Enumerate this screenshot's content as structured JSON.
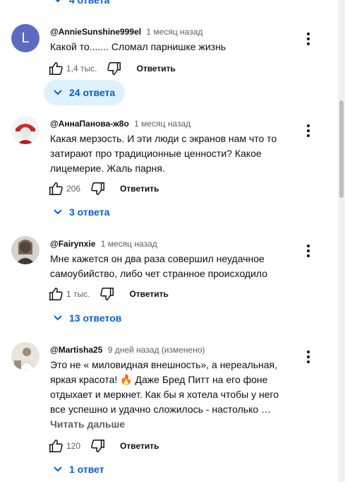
{
  "top_toggle": {
    "label": "4 ответа"
  },
  "comments": [
    {
      "author": "@AnnieSunshine999el",
      "time": "1 месяц назад",
      "avatar_letter": "L",
      "text": "Какой то....... Сломал парнишке жизнь",
      "likes": "1,4 тыс.",
      "reply_label": "Ответить",
      "replies_label": "24 ответа"
    },
    {
      "author": "@АннаПанова-ж8о",
      "time": "1 месяц назад",
      "text": "Какая мерзость. И эти люди с экранов нам что то затирают про традиционные ценности? Какое лицемерие. Жаль парня.",
      "likes": "206",
      "reply_label": "Ответить",
      "replies_label": "3 ответа"
    },
    {
      "author": "@Fairynxie",
      "time": "1 месяц назад",
      "text": "Мне кажется он два раза совершил неудачное самоубийство, либо чет странное происходило",
      "likes": "1 тыс.",
      "reply_label": "Ответить",
      "replies_label": "13 ответов"
    },
    {
      "author": "@Martisha25",
      "time": "9 дней назад (изменено)",
      "text": "Это не « миловидная внешность», а нереальная, яркая красота! 🔥 Даже Бред Питт на его фоне отдыхает и меркнет. Как бы я хотела чтобы у него все успешно и удачно сложилось - настолько …",
      "read_more": "Читать дальше",
      "likes": "120",
      "reply_label": "Ответить",
      "replies_label": "1 ответ"
    }
  ],
  "colors": {
    "link": "#065fd4",
    "highlight": "#def1ff",
    "meta": "#606060"
  }
}
